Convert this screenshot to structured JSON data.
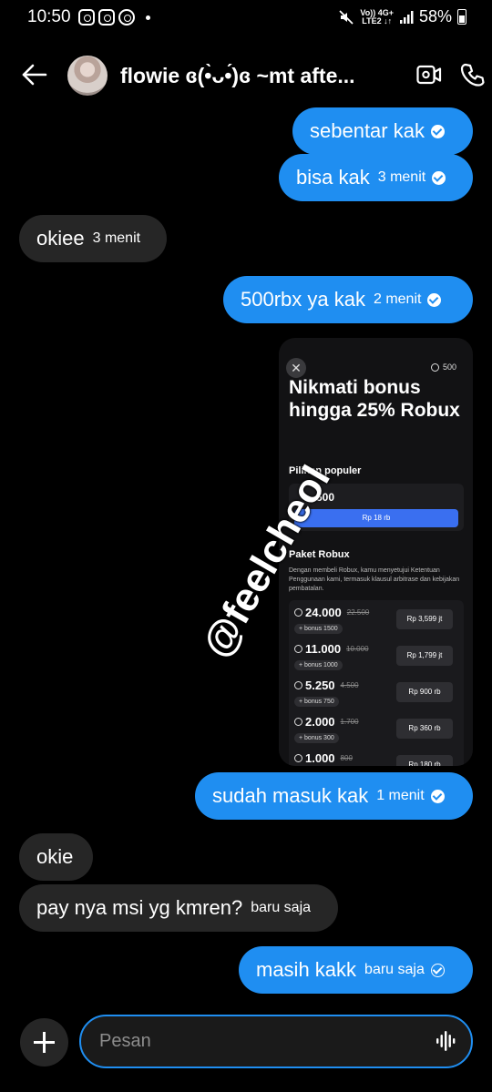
{
  "status_bar": {
    "time": "10:50",
    "network_top": "Vo)) 4G+",
    "network_bottom": "LTE2 ↓↑",
    "battery": "58%"
  },
  "header": {
    "title": "flowie ɞ(•̀ᴗ•́)ɞ ~mt afte..."
  },
  "messages": [
    {
      "text": "sebentar kak",
      "time": "",
      "status": "seen"
    },
    {
      "text": "bisa kak",
      "time": "3 menit",
      "status": "seen"
    },
    {
      "text": "okiee",
      "time": "3 menit"
    },
    {
      "text": "500rbx ya kak",
      "time": "2 menit",
      "status": "seen"
    },
    {
      "text": "sudah masuk kak",
      "time": "1 menit",
      "status": "seen"
    },
    {
      "text": "okie",
      "time": ""
    },
    {
      "text": "pay nya msi yg kmren?",
      "time": "baru saja"
    },
    {
      "text": "masih kakk",
      "time": "baru saja",
      "status": "sent"
    }
  ],
  "shared_image": {
    "balance": "500",
    "headline": "Nikmati bonus hingga 25% Robux",
    "popular_title": "Pilihan populer",
    "popular_amount": "500",
    "popular_price": "Rp 18 rb",
    "packages_title": "Paket Robux",
    "note": "Dengan membeli Robux, kamu menyetujui Ketentuan Penggunaan kami, termasuk klausul arbitrase dan kebijakan pembatalan.",
    "packages": [
      {
        "amount": "24.000",
        "old": "22.500",
        "bonus": "+ bonus 1500",
        "price": "Rp 3,599 jt"
      },
      {
        "amount": "11.000",
        "old": "10.000",
        "bonus": "+ bonus 1000",
        "price": "Rp 1,799 jt"
      },
      {
        "amount": "5.250",
        "old": "4.500",
        "bonus": "+ bonus 750",
        "price": "Rp 900 rb"
      },
      {
        "amount": "2.000",
        "old": "1.700",
        "bonus": "+ bonus 300",
        "price": "Rp 360 rb"
      },
      {
        "amount": "1.000",
        "old": "800",
        "bonus": "",
        "price": "Rp 180 rb"
      }
    ]
  },
  "watermark": "@feelcheol",
  "composer": {
    "placeholder": "Pesan"
  },
  "colors": {
    "outgoing_bubble": "#1f8ef1",
    "incoming_bubble": "#262626",
    "background": "#000000"
  }
}
